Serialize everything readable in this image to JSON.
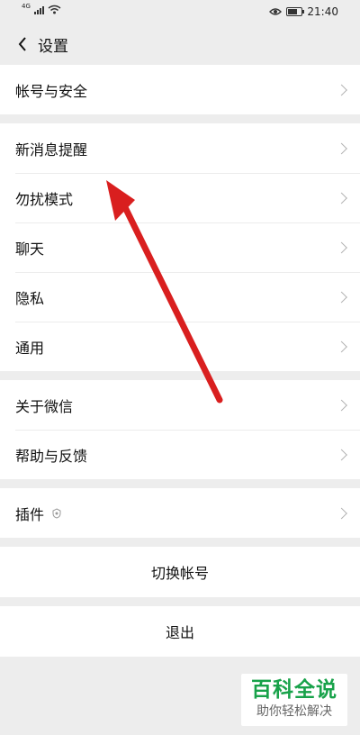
{
  "status_bar": {
    "network_label": "4G",
    "time": "21:40"
  },
  "header": {
    "title": "设置"
  },
  "groups": [
    {
      "items": [
        {
          "label": "帐号与安全"
        }
      ]
    },
    {
      "items": [
        {
          "label": "新消息提醒"
        },
        {
          "label": "勿扰模式"
        },
        {
          "label": "聊天"
        },
        {
          "label": "隐私"
        },
        {
          "label": "通用"
        }
      ]
    },
    {
      "items": [
        {
          "label": "关于微信"
        },
        {
          "label": "帮助与反馈"
        }
      ]
    },
    {
      "items": [
        {
          "label": "插件"
        }
      ]
    }
  ],
  "actions": {
    "switch_account": "切换帐号",
    "logout": "退出"
  },
  "watermark": {
    "title": "百科全说",
    "subtitle": "助你轻松解决"
  },
  "colors": {
    "background": "#ededed",
    "annotation_red": "#d91f1f",
    "watermark_green": "#18a24a"
  },
  "icons": {
    "back": "back-chevron-icon",
    "row_chevron": "chevron-right-icon",
    "plugin": "plugin-shield-icon",
    "eye": "eye-icon",
    "wifi": "wifi-icon",
    "battery": "battery-icon"
  }
}
